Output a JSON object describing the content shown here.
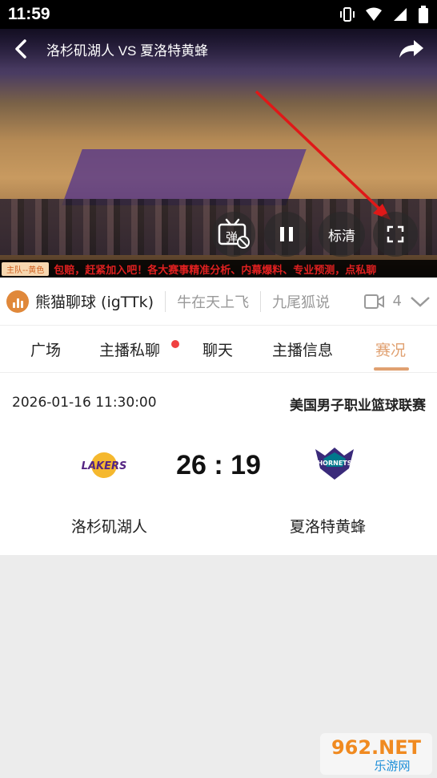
{
  "status_bar": {
    "time": "11:59",
    "icons": [
      "vibrate-icon",
      "wifi-icon",
      "signal-icon",
      "battery-icon"
    ]
  },
  "video": {
    "title": "洛杉矶湖人 VS 夏洛特黄蜂",
    "controls": {
      "danmaku_label": "弹",
      "quality_label": "标清"
    },
    "ticker": {
      "team_tag": "主队--黄色",
      "text": "包赔，赶紧加入吧！各大赛事精准分析、内幕爆料、专业预测，点私聊"
    }
  },
  "streamer_bar": {
    "current_streamer": "熊猫聊球 (igTTk)",
    "other_streamers": [
      "牛在天上飞",
      "九尾狐说"
    ],
    "count": "4"
  },
  "tabs": [
    {
      "label": "广场",
      "active": false
    },
    {
      "label": "主播私聊",
      "active": false
    },
    {
      "label": "聊天",
      "active": false
    },
    {
      "label": "主播信息",
      "active": false
    },
    {
      "label": "赛况",
      "active": true
    }
  ],
  "match": {
    "datetime": "2026-01-16 11:30:00",
    "league": "美国男子职业篮球联赛",
    "home_team": "洛杉矶湖人",
    "away_team": "夏洛特黄蜂",
    "score": "26 : 19",
    "home_logo_text": "LAKERS",
    "away_logo_text": "HORNETS"
  },
  "colors": {
    "accent": "#e0a070",
    "ticker_text": "#e02020",
    "lakers_gold": "#f5b82e",
    "lakers_purple": "#552583",
    "hornets_purple": "#3a2a7a",
    "hornets_teal": "#00788c"
  },
  "watermark": {
    "brand": "962.NET",
    "subtitle": "乐游网"
  }
}
